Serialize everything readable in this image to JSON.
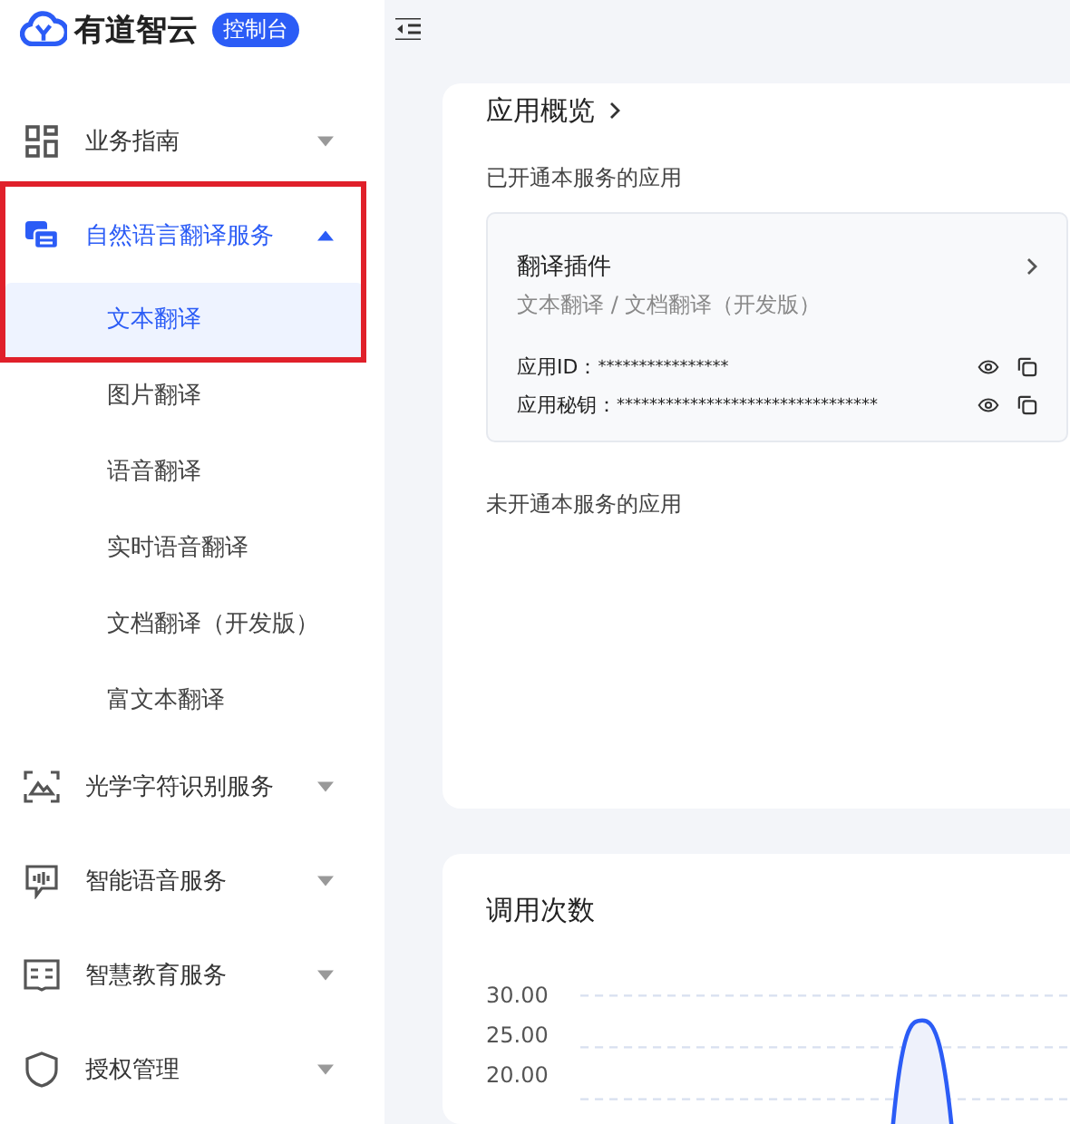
{
  "brand": {
    "name": "有道智云",
    "badge": "控制台"
  },
  "sidebar": {
    "items": [
      {
        "label": "业务指南",
        "expanded": false,
        "highlighted": false
      },
      {
        "label": "自然语言翻译服务",
        "expanded": true,
        "highlighted": true,
        "children": [
          {
            "label": "文本翻译",
            "selected": true
          },
          {
            "label": "图片翻译",
            "selected": false
          },
          {
            "label": "语音翻译",
            "selected": false
          },
          {
            "label": "实时语音翻译",
            "selected": false
          },
          {
            "label": "文档翻译（开发版）",
            "selected": false
          },
          {
            "label": "富文本翻译",
            "selected": false
          }
        ]
      },
      {
        "label": "光学字符识别服务",
        "expanded": false,
        "highlighted": false
      },
      {
        "label": "智能语音服务",
        "expanded": false,
        "highlighted": false
      },
      {
        "label": "智慧教育服务",
        "expanded": false,
        "highlighted": false
      },
      {
        "label": "授权管理",
        "expanded": false,
        "highlighted": false
      }
    ]
  },
  "overview": {
    "title": "应用概览",
    "opened_label": "已开通本服务的应用",
    "app": {
      "name": "翻译插件",
      "services": "文本翻译 / 文档翻译（开发版）",
      "fields": [
        {
          "label": "应用ID：",
          "value": "****************"
        },
        {
          "label": "应用秘钥：",
          "value": "********************************"
        }
      ]
    },
    "unopened_label": "未开通本服务的应用"
  },
  "usage": {
    "title": "调用次数",
    "y_labels": [
      "30.00",
      "25.00",
      "20.00"
    ]
  }
}
